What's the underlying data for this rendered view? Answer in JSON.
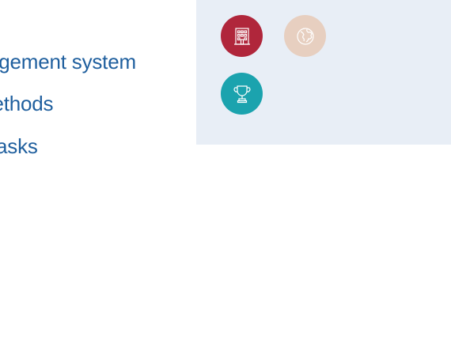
{
  "bullets": [
    {
      "text": "management system"
    },
    {
      "text": "methods"
    },
    {
      "text": "tasks"
    }
  ],
  "icons": [
    {
      "name": "building-icon",
      "color": "#b0263b"
    },
    {
      "name": "globe-icon",
      "color": "#e7cfc0"
    },
    {
      "name": "trophy-icon",
      "color": "#1ba3ae"
    }
  ]
}
